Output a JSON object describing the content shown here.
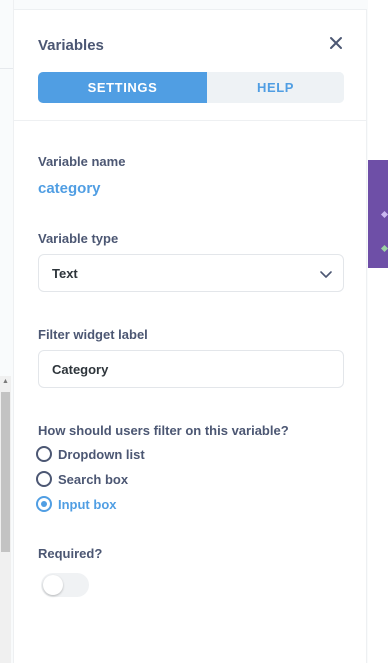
{
  "sidebar": {
    "title": "Variables",
    "tabs": [
      {
        "label": "SETTINGS",
        "active": true
      },
      {
        "label": "HELP",
        "active": false
      }
    ],
    "variable_name": {
      "label": "Variable name",
      "value": "category"
    },
    "variable_type": {
      "label": "Variable type",
      "value": "Text"
    },
    "filter_widget_label": {
      "label": "Filter widget label",
      "value": "Category"
    },
    "filter_mode": {
      "question": "How should users filter on this variable?",
      "options": [
        {
          "label": "Dropdown list",
          "selected": false
        },
        {
          "label": "Search box",
          "selected": false
        },
        {
          "label": "Input box",
          "selected": true
        }
      ]
    },
    "required": {
      "label": "Required?",
      "on": false
    }
  },
  "colors": {
    "accent": "#509ee3",
    "text": "#4c5773",
    "background_purple": "#6e4fa7"
  },
  "icons": {
    "close": "close-icon",
    "chevron": "chevron-down-icon"
  }
}
